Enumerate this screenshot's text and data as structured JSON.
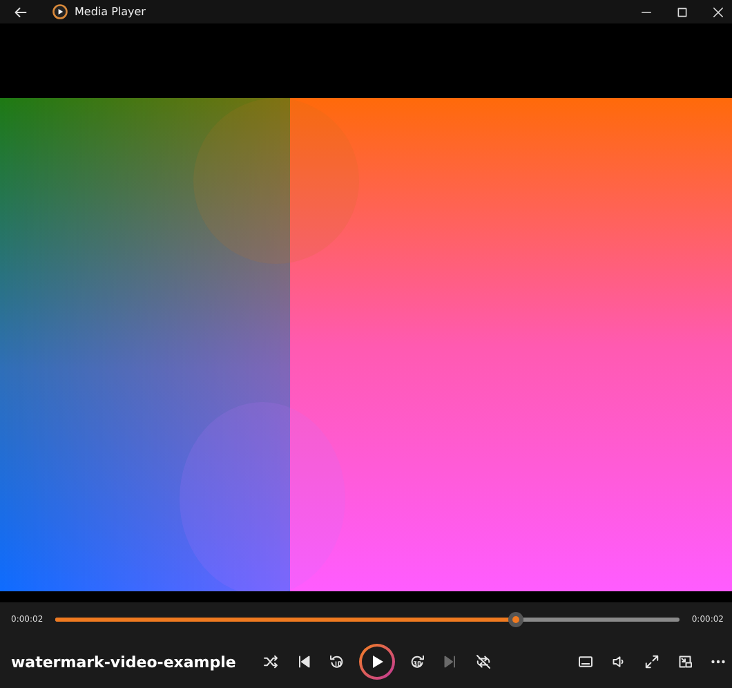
{
  "window": {
    "title": "Media Player"
  },
  "playback": {
    "elapsed": "0:00:02",
    "total": "0:00:02",
    "level": 0.736
  },
  "media": {
    "title": "watermark-video-example"
  },
  "controls": [
    {
      "kind": "shuffle",
      "disabled": false
    },
    {
      "kind": "previous",
      "disabled": false
    },
    {
      "kind": "rewind",
      "disabled": false
    },
    {
      "kind": "play",
      "disabled": false
    },
    {
      "kind": "forward",
      "disabled": false
    },
    {
      "kind": "next",
      "disabled": true
    },
    {
      "kind": "repeat-off",
      "disabled": false
    }
  ],
  "tools": [
    {
      "kind": "captions"
    },
    {
      "kind": "volume"
    },
    {
      "kind": "fullscreen"
    },
    {
      "kind": "miniplayer"
    },
    {
      "kind": "more"
    }
  ]
}
